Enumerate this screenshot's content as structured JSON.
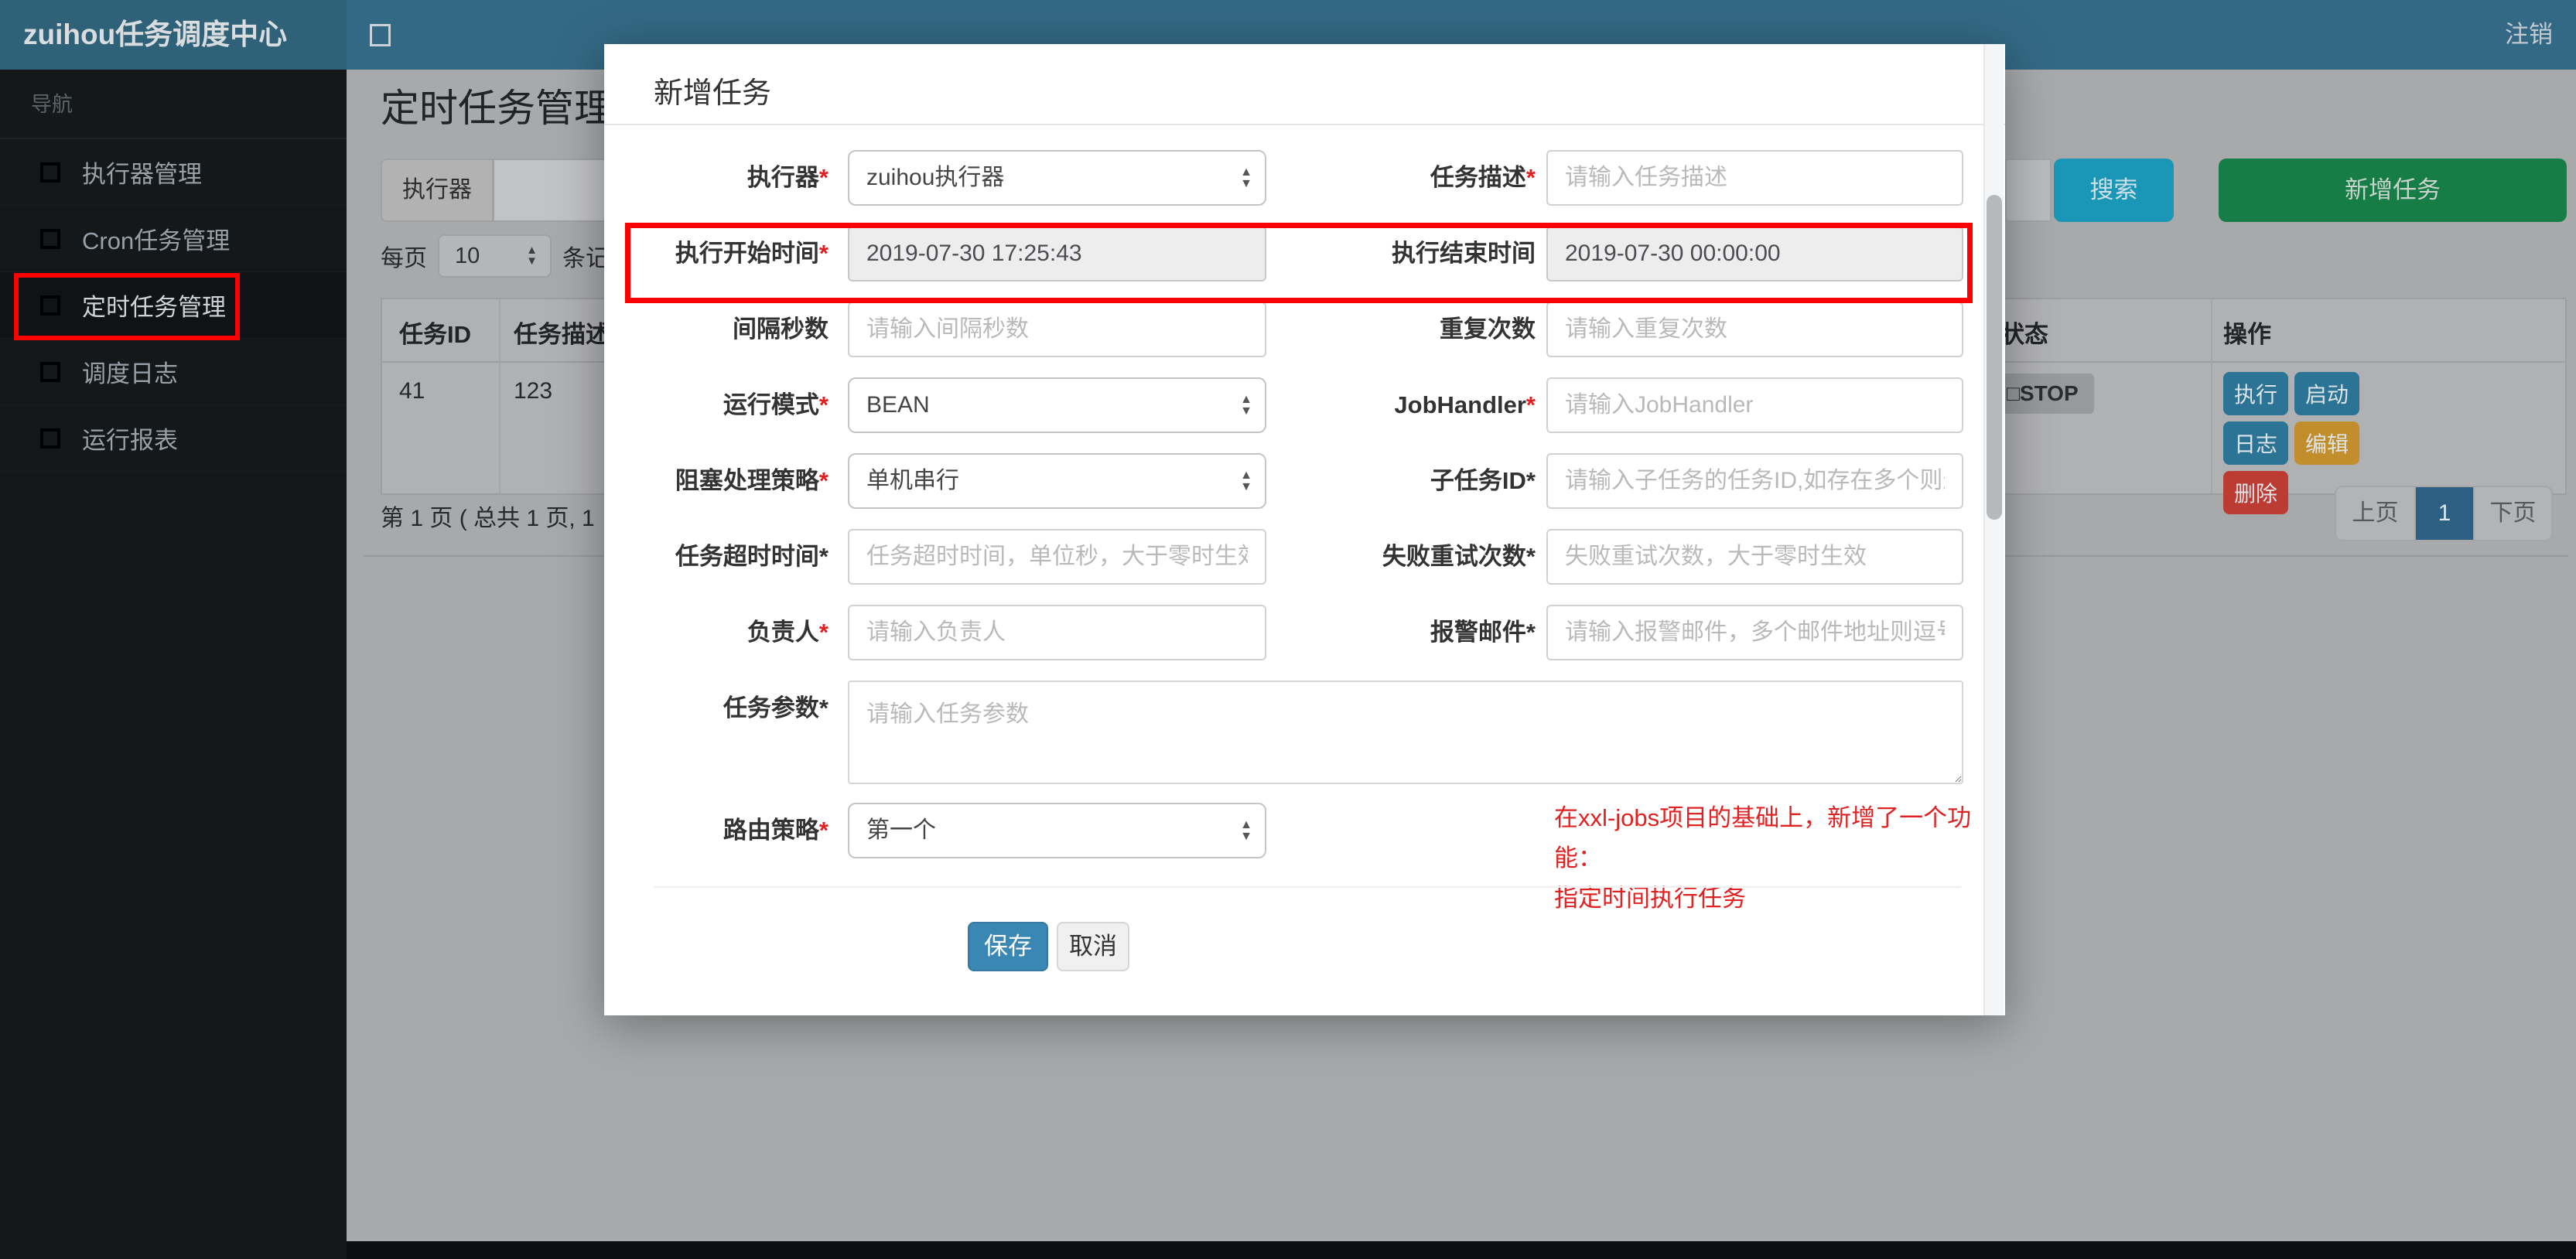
{
  "icons": {
    "select_caret_up": "▲",
    "select_caret_down": "▼"
  },
  "colors": {
    "navbar": "#346985",
    "logo": "#2f6178",
    "sidebar": "#14181b",
    "search_button": "#1a96b6",
    "add_button": "#157d45",
    "save_button": "#3b87b4",
    "active_page": "#2c5f82",
    "annotation": "#fe0000",
    "required_star": "#e02020",
    "action_blue": "#2c7496",
    "action_orange": "#c28e2b",
    "action_red": "#bc3c34"
  },
  "topbar": {
    "brand": "zuihou任务调度中心",
    "logout": "注销"
  },
  "sidebar": {
    "section": "导航",
    "items": [
      {
        "label": "执行器管理",
        "icon_color": "#b8453c"
      },
      {
        "label": "Cron任务管理",
        "icon_color": "#c6902f"
      },
      {
        "label": "定时任务管理",
        "icon_color": "#b9bec2",
        "active": true
      },
      {
        "label": "调度日志",
        "icon_color": "#2e9150"
      },
      {
        "label": "运行报表",
        "icon_color": "#2f9fc6"
      }
    ]
  },
  "page": {
    "title": "定时任务管理",
    "toolbar": {
      "executor_label": "执行器",
      "search_button": "搜索",
      "add_button": "新增任务"
    },
    "per_page": {
      "prefix": "每页",
      "value": "10",
      "suffix": "条记录"
    },
    "table": {
      "headers": [
        "任务ID",
        "任务描述",
        "状态",
        "操作"
      ],
      "row": {
        "id": "41",
        "desc": "123",
        "status": "□STOP",
        "actions": [
          {
            "label": "执行",
            "color": "#2c7496"
          },
          {
            "label": "启动",
            "color": "#2c7496"
          },
          {
            "label": "日志",
            "color": "#2c7496"
          },
          {
            "label": "编辑",
            "color": "#c28e2b"
          },
          {
            "label": "删除",
            "color": "#bc3c34"
          }
        ]
      }
    },
    "summary": "第 1 页 ( 总共 1 页, 1",
    "pagination": {
      "prev": "上页",
      "current": "1",
      "next": "下页"
    }
  },
  "modal": {
    "title": "新增任务",
    "fields": [
      {
        "label": "执行器",
        "star": "*",
        "type": "select",
        "value": "zuihou执行器"
      },
      {
        "label": "任务描述",
        "star": "*",
        "type": "input",
        "placeholder": "请输入任务描述"
      },
      {
        "label": "执行开始时间",
        "star": "*",
        "type": "date",
        "value": "2019-07-30 17:25:43"
      },
      {
        "label": "执行结束时间",
        "star": "",
        "type": "date",
        "value": "2019-07-30 00:00:00"
      },
      {
        "label": "间隔秒数",
        "star": "",
        "type": "input",
        "placeholder": "请输入间隔秒数"
      },
      {
        "label": "重复次数",
        "star": "",
        "type": "input",
        "placeholder": "请输入重复次数"
      },
      {
        "label": "运行模式",
        "star": "*",
        "type": "select",
        "value": "BEAN"
      },
      {
        "label": "JobHandler",
        "star": "*",
        "type": "input",
        "placeholder": "请输入JobHandler"
      },
      {
        "label": "阻塞处理策略",
        "star": "*",
        "type": "select",
        "value": "单机串行"
      },
      {
        "label": "子任务ID",
        "star": "*",
        "type": "input",
        "placeholder": "请输入子任务的任务ID,如存在多个则逗"
      },
      {
        "label": "任务超时时间",
        "star": "*",
        "type": "input",
        "placeholder": "任务超时时间，单位秒，大于零时生效"
      },
      {
        "label": "失败重试次数",
        "star": "*",
        "type": "input",
        "placeholder": "失败重试次数，大于零时生效"
      },
      {
        "label": "负责人",
        "star": "*",
        "type": "input",
        "placeholder": "请输入负责人"
      },
      {
        "label": "报警邮件",
        "star": "*",
        "type": "input",
        "placeholder": "请输入报警邮件，多个邮件地址则逗号分"
      },
      {
        "label": "任务参数",
        "star": "*",
        "type": "textarea",
        "placeholder": "请输入任务参数"
      },
      {
        "label": "路由策略",
        "star": "*",
        "type": "select",
        "value": "第一个"
      }
    ],
    "note_line1": "在xxl-jobs项目的基础上，新增了一个功能：",
    "note_line2": "指定时间执行任务",
    "save_button": "保存",
    "cancel_button": "取消"
  }
}
